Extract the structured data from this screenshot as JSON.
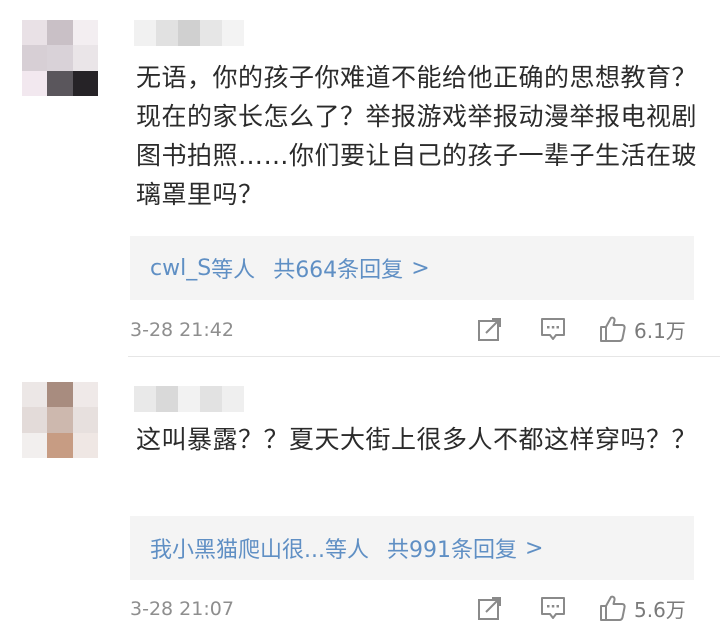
{
  "comments": [
    {
      "text": "无语，你的孩子你难道不能给他正确的思想教育？现在的家长怎么了？举报游戏举报动漫举报电视剧图书拍照……你们要让自己的孩子一辈子生活在玻璃罩里吗？",
      "reply_users": "cwl_S",
      "reply_users_suffix": "等人",
      "reply_count_label": "共664条回复",
      "reply_arrow": ">",
      "timestamp": "3-28 21:42",
      "like_count": "6.1万"
    },
    {
      "text": "这叫暴露？？夏天大街上很多人不都这样穿吗？？",
      "reply_users": "我小黑猫爬山很...",
      "reply_users_suffix": "等人",
      "reply_count_label": "共991条回复",
      "reply_arrow": ">",
      "timestamp": "3-28 21:07",
      "like_count": "5.6万"
    }
  ],
  "icons": {
    "share": "share-icon",
    "reply": "comment-icon",
    "like": "thumbs-up-icon"
  },
  "colors": {
    "link_blue": "#5f8fc4",
    "reply_box_bg": "#f4f4f4",
    "meta_gray": "#8e8e8e",
    "icon_gray": "#8a8a8a"
  }
}
